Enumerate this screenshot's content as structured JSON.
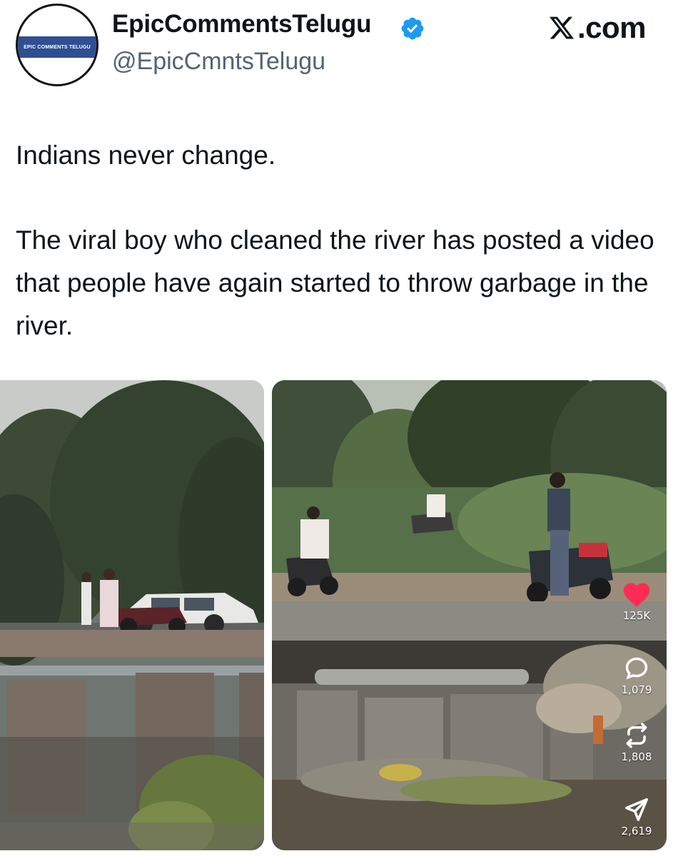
{
  "account": {
    "display_name": "EpicCommentsTelugu",
    "handle": "@EpicCmntsTelugu",
    "avatar_text": "EPIC COMMENTS TELUGU",
    "verified_icon": "verified-badge-icon",
    "verified_color": "#1d9bf0"
  },
  "brand": {
    "label": ".com",
    "icon": "x-logo-icon"
  },
  "tweet": {
    "paragraph_1": "Indians never change.",
    "paragraph_2": "The viral boy who cleaned the river has posted a video that people have again started to throw garbage in the river."
  },
  "media": {
    "left_image_icon": "photo-river-bridge-car",
    "right_image_icon": "photo-river-bridge-scooter"
  },
  "video_overlay": {
    "likes": "125K",
    "comments": "1,079",
    "reposts": "1,808",
    "shares": "2,619",
    "like_color": "#fe2c55"
  }
}
